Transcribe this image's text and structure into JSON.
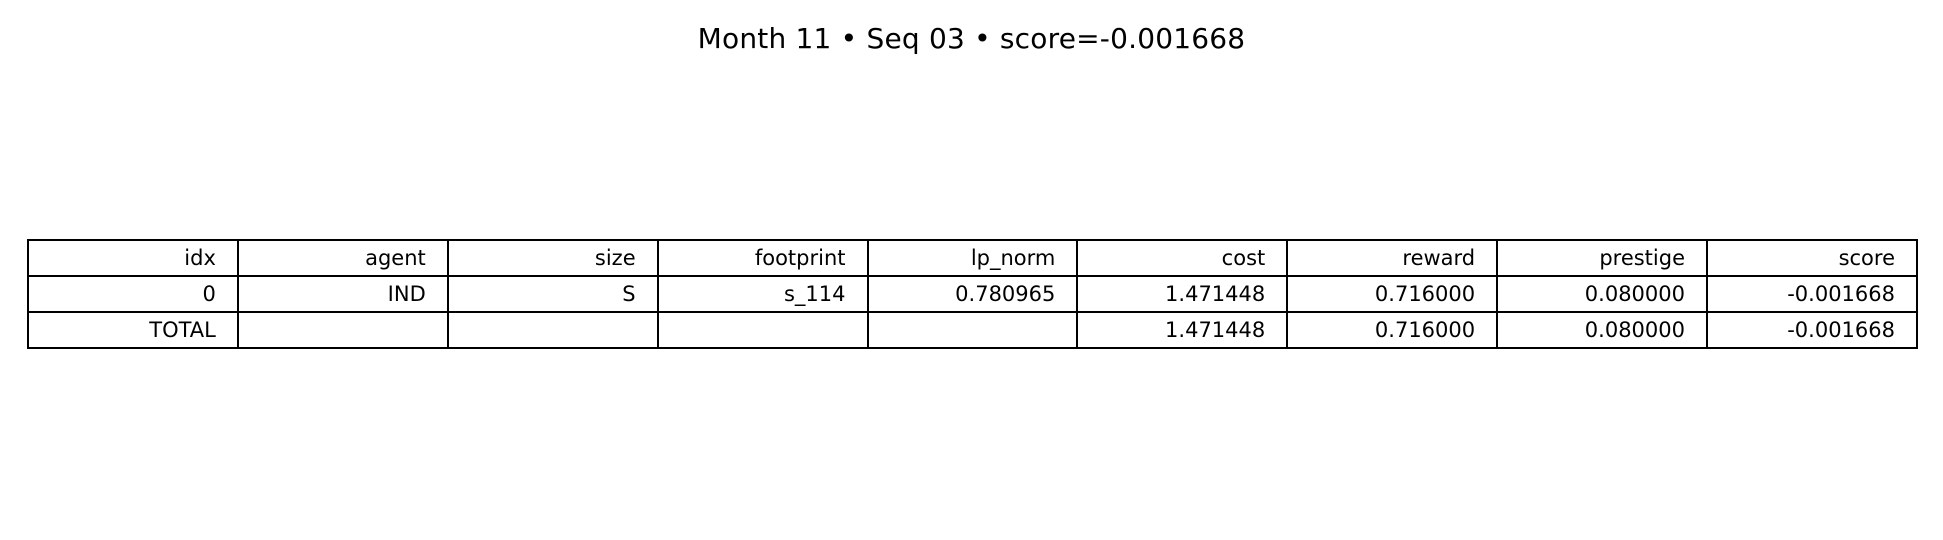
{
  "title": "Month 11 • Seq 03 • score=-0.001668",
  "chart_data": {
    "type": "table",
    "title": "Month 11 • Seq 03 • score=-0.001668",
    "columns": [
      "idx",
      "agent",
      "size",
      "footprint",
      "lp_norm",
      "cost",
      "reward",
      "prestige",
      "score"
    ],
    "rows": [
      [
        "0",
        "IND",
        "S",
        "s_114",
        "0.780965",
        "1.471448",
        "0.716000",
        "0.080000",
        "-0.001668"
      ],
      [
        "TOTAL",
        "",
        "",
        "",
        "",
        "1.471448",
        "0.716000",
        "0.080000",
        "-0.001668"
      ]
    ]
  }
}
